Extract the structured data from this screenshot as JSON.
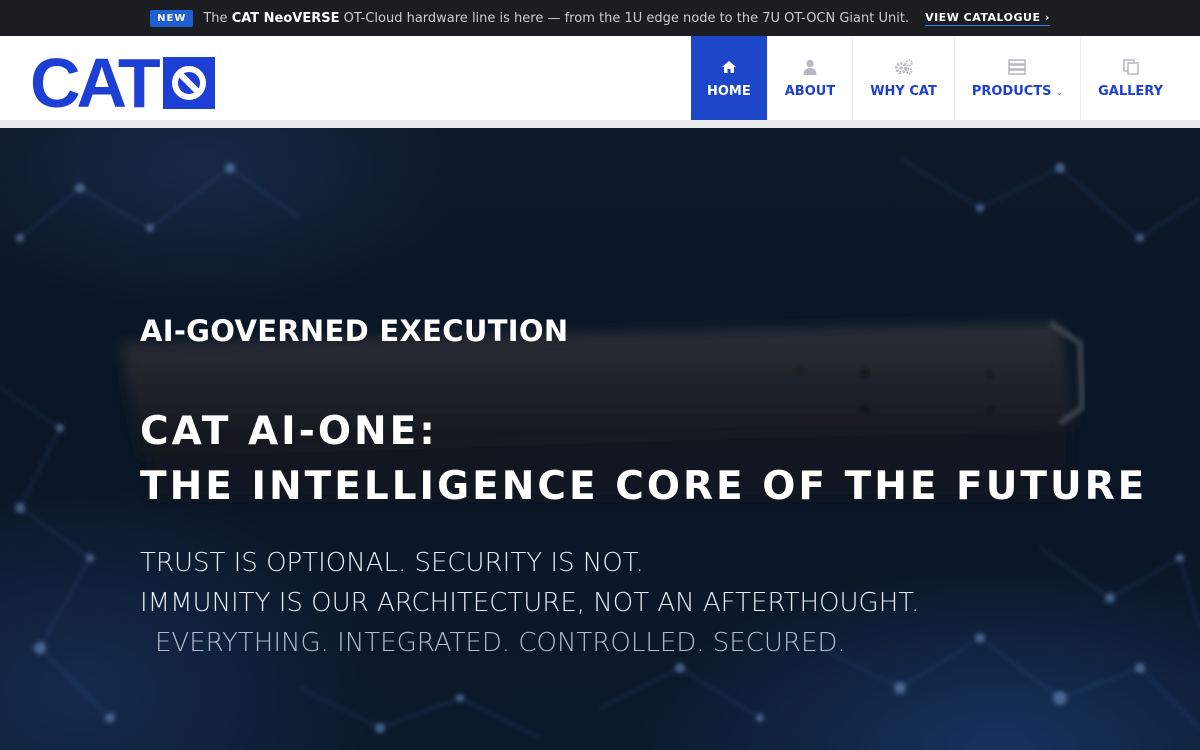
{
  "announcement": {
    "badge": "NEW",
    "prefix": "The",
    "product": "CAT NeoVERSE",
    "message": "OT-Cloud hardware line is here — from the 1U edge node to the 7U OT-OCN Giant Unit.",
    "link_label": "VIEW CATALOGUE ›"
  },
  "header": {
    "logo_text": "CAT",
    "logo_icon": "no-entry-icon",
    "nav": [
      {
        "label": "HOME",
        "icon": "home-icon",
        "active": true
      },
      {
        "label": "ABOUT",
        "icon": "user-icon"
      },
      {
        "label": "WHY CAT",
        "icon": "gears-icon"
      },
      {
        "label": "PRODUCTS",
        "icon": "server-icon",
        "caret": "⌄"
      },
      {
        "label": "GALLERY",
        "icon": "copy-icon"
      }
    ]
  },
  "hero": {
    "eyebrow": "AI-GOVERNED EXECUTION",
    "headline_line1": "CAT AI-ONE:",
    "headline_line2": "THE INTELLIGENCE CORE OF THE FUTURE",
    "tagline_line1": "TRUST IS OPTIONAL. SECURITY IS NOT.",
    "tagline_line2": "IMMUNITY IS OUR ARCHITECTURE, NOT AN AFTERTHOUGHT.",
    "tagline_line3": "EVERYTHING. INTEGRATED. CONTROLLED. SECURED."
  },
  "colors": {
    "brand_blue": "#1d3fd4",
    "active_nav": "#1d47c8",
    "topbar_bg": "#1c1d21",
    "badge_blue": "#1f5fd1"
  }
}
